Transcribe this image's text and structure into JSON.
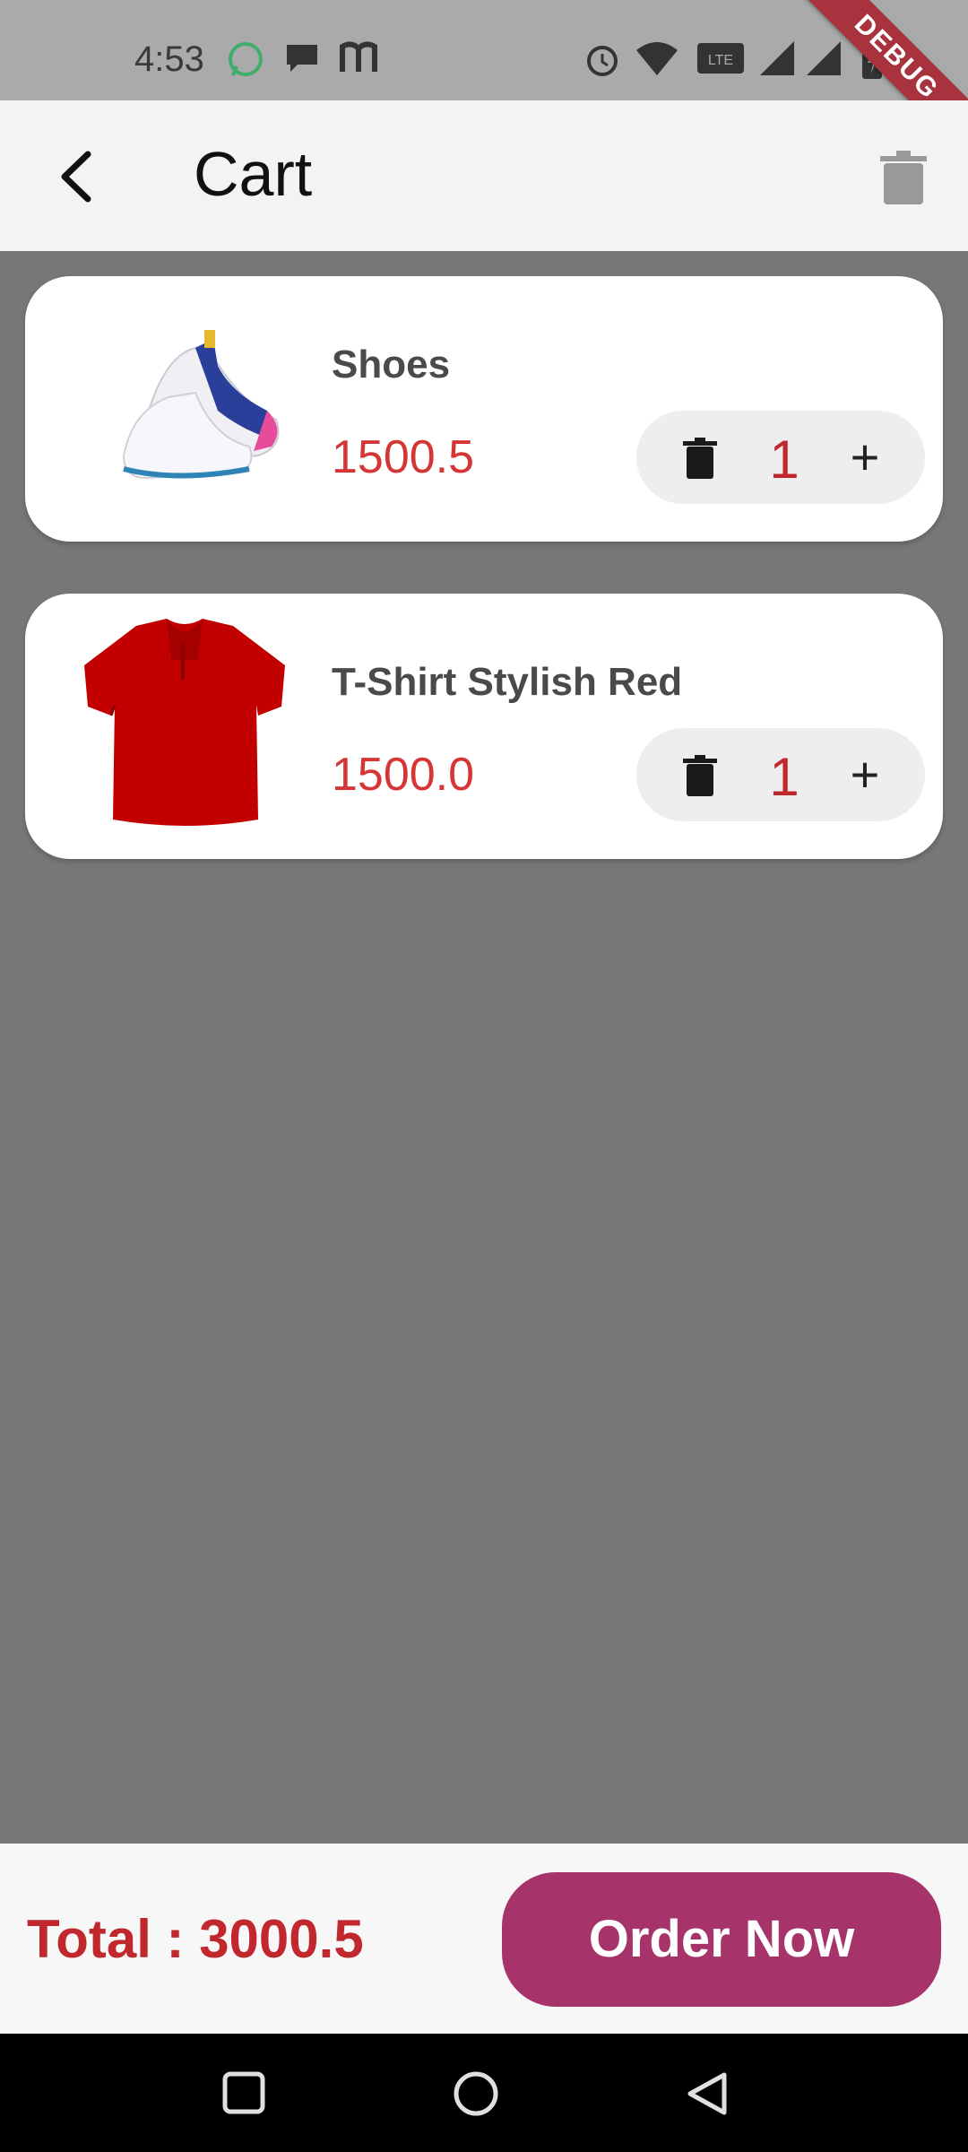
{
  "status_bar": {
    "time": "4:53",
    "icons": [
      "whatsapp-icon",
      "message-icon",
      "m-app-icon",
      "alarm-icon",
      "wifi-icon",
      "volte-icon",
      "signal-icon",
      "signal-icon",
      "battery-icon"
    ],
    "debug_label": "DEBUG"
  },
  "appbar": {
    "title": "Cart"
  },
  "items": [
    {
      "name": "Shoes",
      "price": "1500.5",
      "qty": "1",
      "plus": "+"
    },
    {
      "name": "T-Shirt Stylish Red",
      "price": "1500.0",
      "qty": "1",
      "plus": "+"
    }
  ],
  "footer": {
    "total": "Total : 3000.5",
    "order_label": "Order Now"
  },
  "colors": {
    "accent": "#a6336a",
    "price": "#d63535",
    "qty": "#c0282e"
  }
}
